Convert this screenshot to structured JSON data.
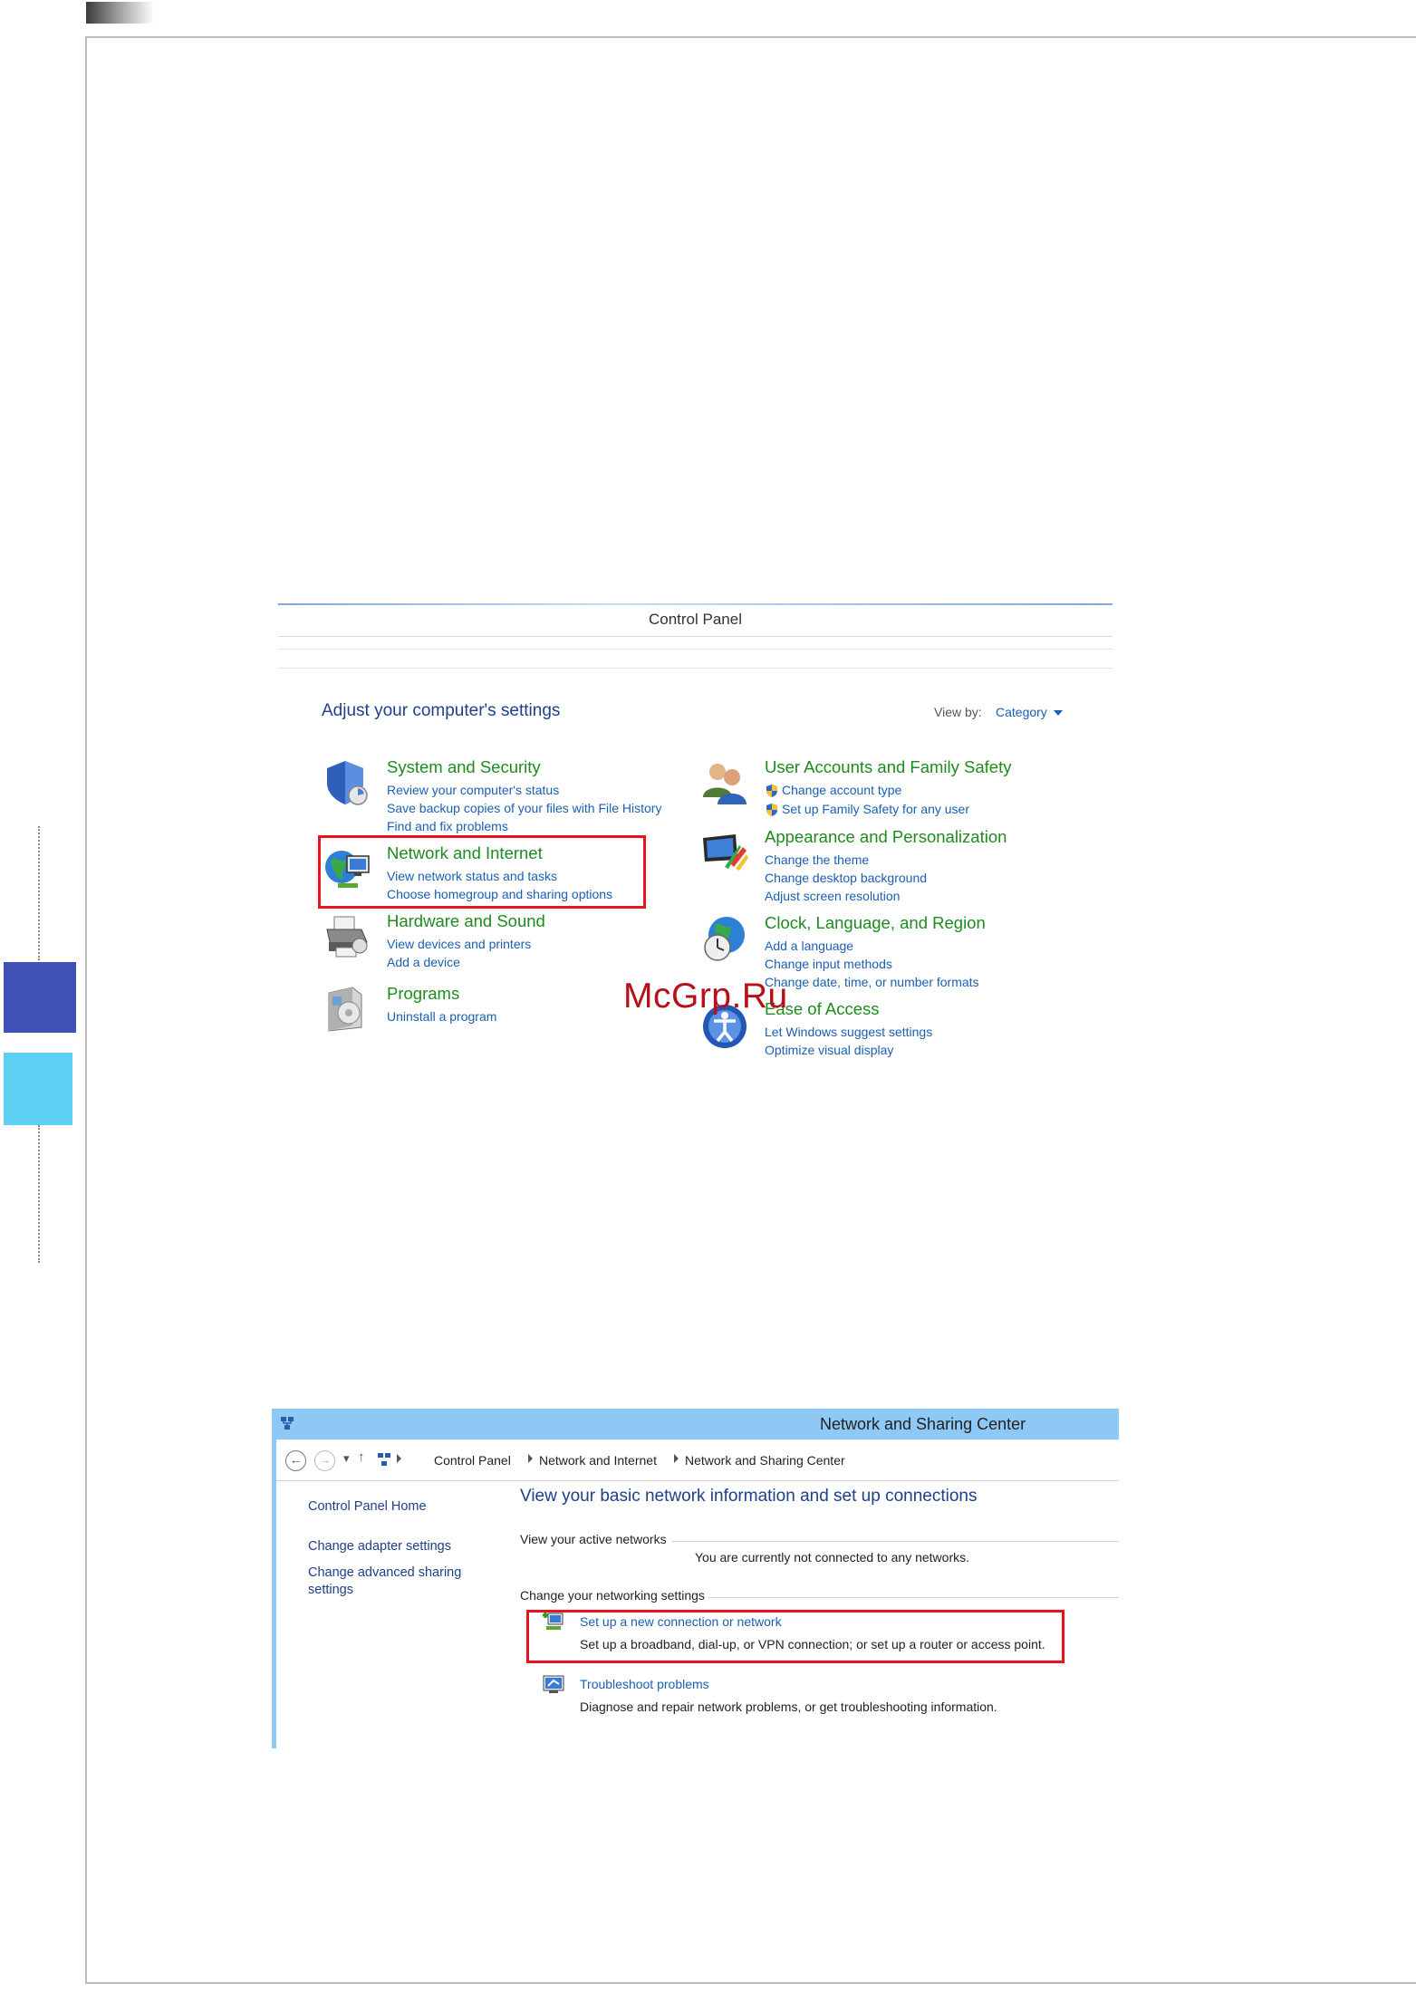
{
  "control_panel": {
    "window_title": "Control Panel",
    "heading": "Adjust your computer's settings",
    "view_by_label": "View by:",
    "view_by_value": "Category",
    "categories": [
      {
        "title": "System and Security",
        "icon": "shield-security-icon",
        "links": [
          "Review your computer's status",
          "Save backup copies of your files with File History",
          "Find and fix problems"
        ]
      },
      {
        "title": "Network and Internet",
        "icon": "globe-network-icon",
        "links": [
          "View network status and tasks",
          "Choose homegroup and sharing options"
        ]
      },
      {
        "title": "Hardware and Sound",
        "icon": "printer-icon",
        "links": [
          "View devices and printers",
          "Add a device"
        ]
      },
      {
        "title": "Programs",
        "icon": "programs-box-icon",
        "links": [
          "Uninstall a program"
        ]
      },
      {
        "title": "User Accounts and Family Safety",
        "icon": "users-icon",
        "links": [
          "Change account type",
          "Set up Family Safety for any user"
        ]
      },
      {
        "title": "Appearance and Personalization",
        "icon": "monitor-paint-icon",
        "links": [
          "Change the theme",
          "Change desktop background",
          "Adjust screen resolution"
        ]
      },
      {
        "title": "Clock, Language, and Region",
        "icon": "clock-globe-icon",
        "links": [
          "Add a language",
          "Change input methods",
          "Change date, time, or number formats"
        ]
      },
      {
        "title": "Ease of Access",
        "icon": "ease-of-access-icon",
        "links": [
          "Let Windows suggest settings",
          "Optimize visual display"
        ]
      }
    ]
  },
  "watermark": "McGrp.Ru",
  "network_center": {
    "window_title": "Network and Sharing Center",
    "breadcrumb": [
      "Control Panel",
      "Network and Internet",
      "Network and Sharing Center"
    ],
    "left_links": [
      "Control Panel Home",
      "Change adapter settings",
      "Change advanced sharing settings"
    ],
    "heading": "View your basic network information and set up connections",
    "active_networks_label": "View your active networks",
    "not_connected_msg": "You are currently not connected to any networks.",
    "change_settings_label": "Change your networking settings",
    "tasks": [
      {
        "link": "Set up a new connection or network",
        "desc": "Set up a broadband, dial-up, or VPN connection; or set up a router or access point."
      },
      {
        "link": "Troubleshoot problems",
        "desc": "Diagnose and repair network problems, or get troubleshooting information."
      }
    ]
  },
  "colors": {
    "category_title": "#1f8a1f",
    "link": "#1a5fb4",
    "heading": "#1e3f8a",
    "highlight_box": "#e8131e",
    "titlebar": "#8ec8f4",
    "side_block_dark": "#3f51b5",
    "side_block_light": "#5ed0f3"
  }
}
